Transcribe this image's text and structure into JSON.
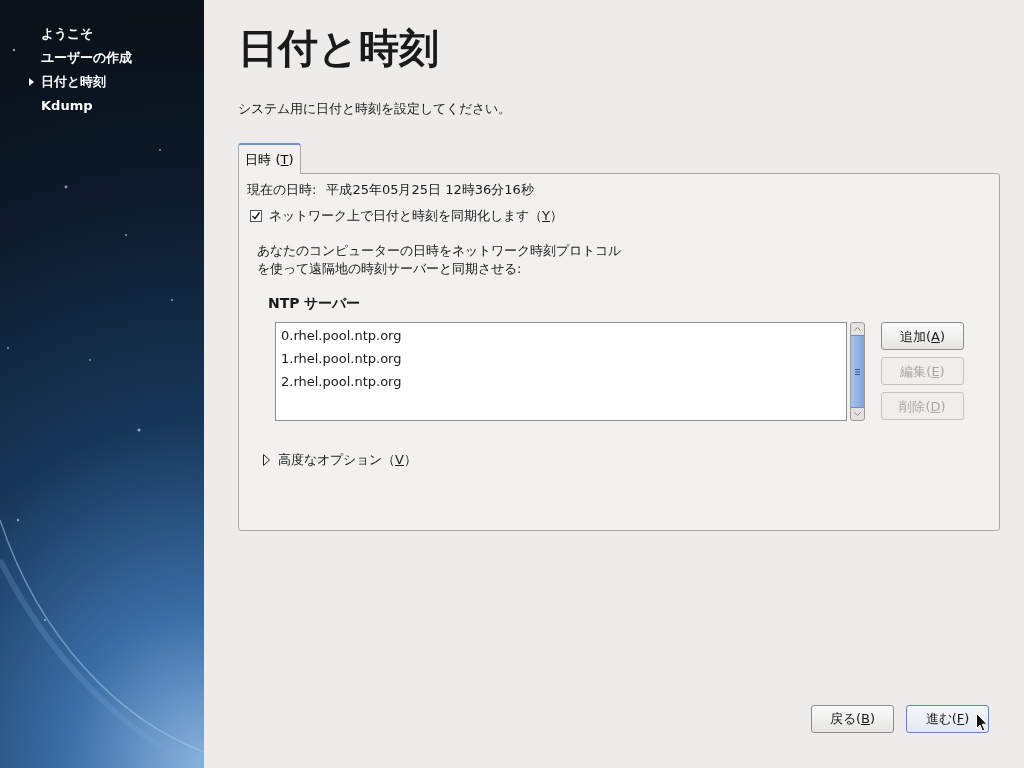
{
  "sidebar": {
    "items": [
      {
        "label": "ようこそ",
        "selected": false
      },
      {
        "label": "ユーザーの作成",
        "selected": false
      },
      {
        "label": "日付と時刻",
        "selected": true
      },
      {
        "label": "Kdump",
        "selected": false
      }
    ]
  },
  "page": {
    "title": "日付と時刻",
    "subtitle": "システム用に日付と時刻を設定してください。"
  },
  "tabs": [
    {
      "label": "日時 (",
      "key": "T",
      "tail": ")",
      "selected": true
    }
  ],
  "panel": {
    "current_time": {
      "label": "現在の日時:",
      "value": "平成25年05月25日 12時36分16秒"
    },
    "sync_checkbox": {
      "label": "ネットワーク上で日付と時刻を同期化します（",
      "key": "Y",
      "tail": "）",
      "checked": true
    },
    "description": [
      "あなたのコンピューターの日時をネットワーク時刻プロトコル",
      "を使って遠隔地の時刻サーバーと同期させる:"
    ],
    "ntp": {
      "heading": "NTP サーバー",
      "servers": [
        {
          "name": "0.rhel.pool.ntp.org",
          "selected": false
        },
        {
          "name": "1.rhel.pool.ntp.org",
          "selected": false
        },
        {
          "name": "2.rhel.pool.ntp.org",
          "selected": false
        }
      ],
      "buttons": [
        {
          "label": "追加(",
          "key": "A",
          "tail": ")",
          "disabled": false
        },
        {
          "label": "編集(",
          "key": "E",
          "tail": ")",
          "disabled": true
        },
        {
          "label": "削除(",
          "key": "D",
          "tail": ")",
          "disabled": true
        }
      ]
    },
    "advanced": {
      "label": "高度なオプション（",
      "key": "V",
      "tail": "）",
      "expanded": false
    }
  },
  "nav_buttons": [
    {
      "label": "戻る(",
      "key": "B",
      "tail": ")",
      "focused": false
    },
    {
      "label": "進む(",
      "key": "F",
      "tail": ")",
      "focused": true
    }
  ]
}
